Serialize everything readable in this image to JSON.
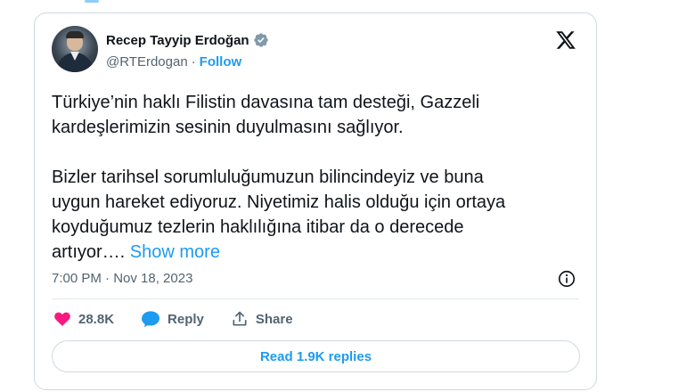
{
  "author": {
    "name": "Recep Tayyip Erdoğan",
    "handle": "@RTErdogan",
    "separator": "·",
    "follow_label": "Follow"
  },
  "tweet": {
    "text": "Türkiye’nin haklı Filistin davasına tam desteği, Gazzeli\nkardeşlerimizin sesinin duyulmasını sağlıyor.\n\nBizler tarihsel sorumluluğumuzun bilincindeyiz ve buna\nuygun hareket ediyoruz. Niyetimiz halis olduğu için ortaya\nkoyduğumuz tezlerin haklılığına itibar da o derecede\nartıyor…. ",
    "show_more": "Show more",
    "timestamp": "7:00 PM · Nov 18, 2023"
  },
  "actions": {
    "likes": "28.8K",
    "reply_label": "Reply",
    "share_label": "Share"
  },
  "replies_button": "Read 1.9K replies",
  "colors": {
    "accent": "#1d9bf0",
    "like": "#f91880",
    "verified": "#829aab",
    "muted": "#536471",
    "border": "#cfd9de"
  },
  "icons": [
    "verified-badge-icon",
    "x-logo-icon",
    "info-icon",
    "heart-icon",
    "reply-bubble-icon",
    "share-icon"
  ]
}
